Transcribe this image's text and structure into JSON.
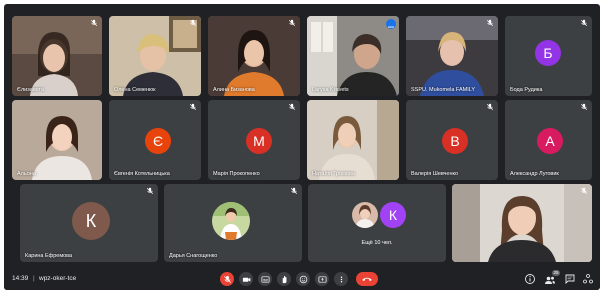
{
  "participants": [
    {
      "name": "Єлизавета",
      "kind": "video"
    },
    {
      "name": "Олена Семенюк",
      "kind": "video"
    },
    {
      "name": "Алина Бизанова",
      "kind": "video"
    },
    {
      "name": "Larysa Kravets",
      "kind": "video",
      "active": true
    },
    {
      "name": "SSPU. Mukomela FAMILY",
      "kind": "video"
    },
    {
      "name": "Бода Рудика",
      "kind": "avatar",
      "initial": "Б",
      "color": "#9334e6"
    },
    {
      "name": "Альона",
      "kind": "video"
    },
    {
      "name": "Євгенія Котельницька",
      "kind": "avatar",
      "initial": "Є",
      "color": "#e8430a"
    },
    {
      "name": "Марія Прокопенко",
      "kind": "avatar",
      "initial": "М",
      "color": "#d93025"
    },
    {
      "name": "Наталія Громова",
      "kind": "video"
    },
    {
      "name": "Валерія Шевченко",
      "kind": "avatar",
      "initial": "В",
      "color": "#d93025"
    },
    {
      "name": "Александр Луговик",
      "kind": "avatar",
      "initial": "А",
      "color": "#d81b60"
    },
    {
      "name": "Карина Ефремова",
      "kind": "avatar",
      "initial": "К",
      "color": "#7f5a4c"
    },
    {
      "name": "Дарья Снагощенко",
      "kind": "photo"
    },
    {
      "name": "Ещё 10 чел.",
      "kind": "others",
      "initial": "К",
      "color": "#a142f4"
    },
    {
      "name": "",
      "kind": "video-self"
    }
  ],
  "bottom_bar": {
    "time": "14:39",
    "meeting_code": "wpz-oker-tce",
    "participant_count": "25"
  },
  "controls": [
    {
      "icon": "mic-off-icon"
    },
    {
      "icon": "camera-icon"
    },
    {
      "icon": "captions-icon"
    },
    {
      "icon": "raise-hand-icon"
    },
    {
      "icon": "emoji-icon"
    },
    {
      "icon": "present-screen-icon"
    },
    {
      "icon": "more-options-icon"
    },
    {
      "icon": "end-call-icon"
    }
  ]
}
